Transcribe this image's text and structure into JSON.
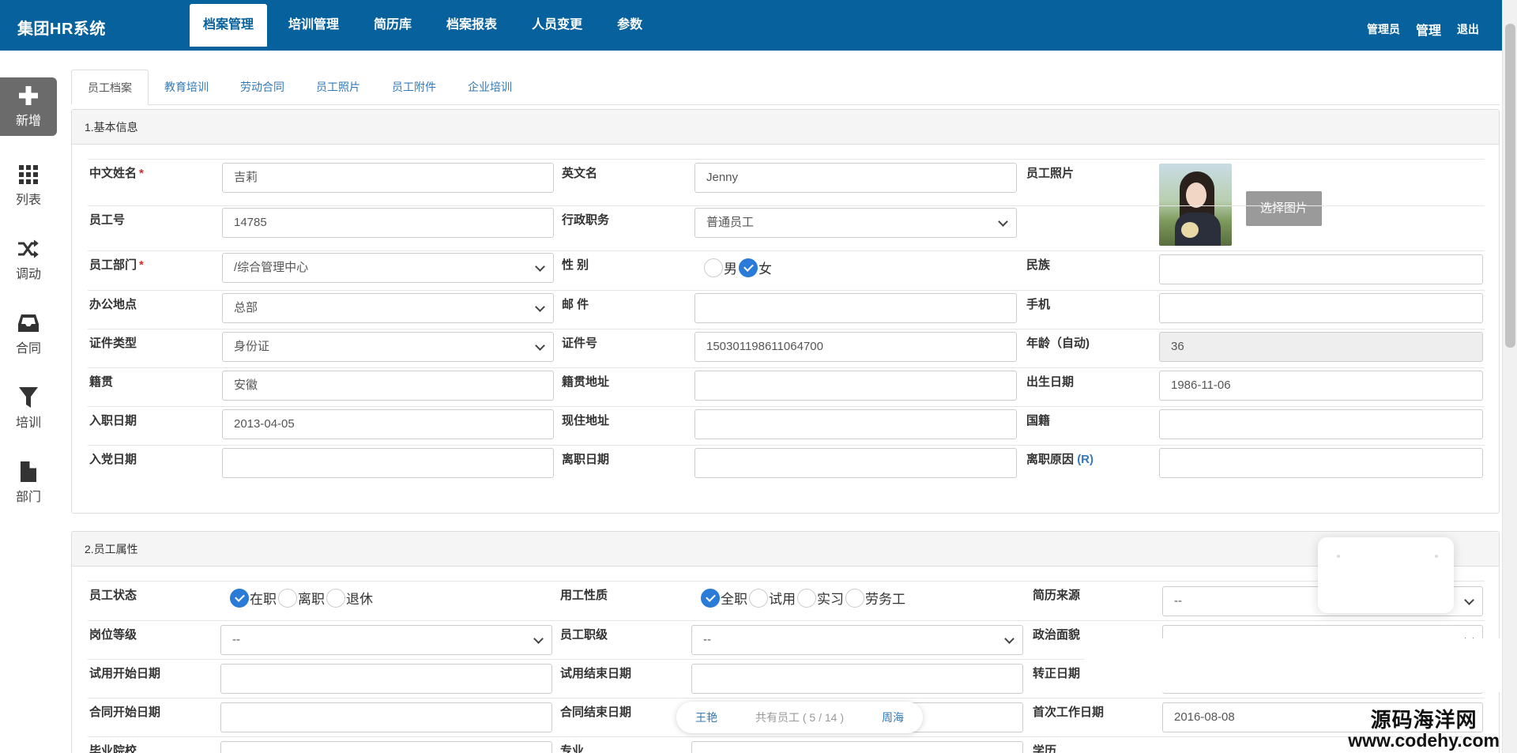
{
  "app": {
    "brand": "集团HR系统"
  },
  "nav": {
    "items": [
      "档案管理",
      "培训管理",
      "简历库",
      "档案报表",
      "人员变更",
      "参数"
    ]
  },
  "user_menu": {
    "role": "管理员",
    "manage": "管理",
    "logout": "退出"
  },
  "sidebar": {
    "items": [
      {
        "label": "新增",
        "icon": "plus-icon"
      },
      {
        "label": "列表",
        "icon": "grid-icon"
      },
      {
        "label": "调动",
        "icon": "shuffle-icon"
      },
      {
        "label": "合同",
        "icon": "inbox-icon"
      },
      {
        "label": "培训",
        "icon": "filter-icon"
      },
      {
        "label": "部门",
        "icon": "file-icon"
      }
    ]
  },
  "tabs": [
    "员工档案",
    "教育培训",
    "劳动合同",
    "员工照片",
    "员工附件",
    "企业培训"
  ],
  "section1": {
    "title": "1.基本信息",
    "cn_name": {
      "label": "中文姓名",
      "required": "*",
      "value": "吉莉"
    },
    "en_name": {
      "label": "英文名",
      "value": "Jenny"
    },
    "photo": {
      "label": "员工照片",
      "button": "选择图片"
    },
    "emp_no": {
      "label": "员工号",
      "value": "14785"
    },
    "position": {
      "label": "行政职务",
      "value": "普通员工"
    },
    "dept": {
      "label": "员工部门",
      "required": "*",
      "value": "/综合管理中心"
    },
    "gender": {
      "label": "性 别",
      "options": [
        "男",
        "女"
      ]
    },
    "ethnicity": {
      "label": "民族",
      "value": ""
    },
    "office": {
      "label": "办公地点",
      "value": "总部"
    },
    "email": {
      "label": "邮 件",
      "value": ""
    },
    "mobile": {
      "label": "手机",
      "value": ""
    },
    "id_type": {
      "label": "证件类型",
      "value": "身份证"
    },
    "id_no": {
      "label": "证件号",
      "value": "150301198611064700"
    },
    "age": {
      "label": "年龄（自动)",
      "value": "36"
    },
    "native": {
      "label": "籍贯",
      "value": "安徽"
    },
    "native_addr": {
      "label": "籍贯地址",
      "value": ""
    },
    "birth": {
      "label": "出生日期",
      "value": "1986-11-06"
    },
    "join_date": {
      "label": "入职日期",
      "value": "2013-04-05"
    },
    "cur_addr": {
      "label": "现住地址",
      "value": ""
    },
    "nationality": {
      "label": "国籍",
      "value": ""
    },
    "party_date": {
      "label": "入党日期",
      "value": ""
    },
    "leave_date": {
      "label": "离职日期",
      "value": ""
    },
    "leave_reason": {
      "label": "离职原因",
      "suffix": "(R)",
      "value": ""
    }
  },
  "section2": {
    "title": "2.员工属性",
    "status": {
      "label": "员工状态",
      "options": [
        "在职",
        "离职",
        "退休"
      ]
    },
    "nature": {
      "label": "用工性质",
      "options": [
        "全职",
        "试用",
        "实习",
        "劳务工"
      ]
    },
    "resume_src": {
      "label": "简历来源",
      "value": "--"
    },
    "post_level": {
      "label": "岗位等级",
      "value": "--"
    },
    "emp_level": {
      "label": "员工职级",
      "value": "--"
    },
    "politics": {
      "label": "政治面貌",
      "value": ""
    },
    "trial_start": {
      "label": "试用开始日期",
      "value": ""
    },
    "trial_end": {
      "label": "试用结束日期",
      "value": ""
    },
    "regular_date": {
      "label": "转正日期",
      "value": ""
    },
    "contract_start": {
      "label": "合同开始日期",
      "value": ""
    },
    "contract_end": {
      "label": "合同结束日期",
      "value": ""
    },
    "first_work": {
      "label": "首次工作日期",
      "value": "2016-08-08"
    },
    "school": {
      "label": "毕业院校"
    },
    "major": {
      "label": "专业"
    },
    "education": {
      "label": "学历"
    }
  },
  "pager": {
    "prev": "王艳",
    "count": "共有员工 ( 5 / 14 )",
    "next": "周海"
  },
  "watermark": {
    "cn": "源码海洋网",
    "en": "www.codehy.com"
  },
  "colors": {
    "topbar": "#07619c",
    "accent": "#2a7bd8",
    "link": "#337ab7"
  }
}
